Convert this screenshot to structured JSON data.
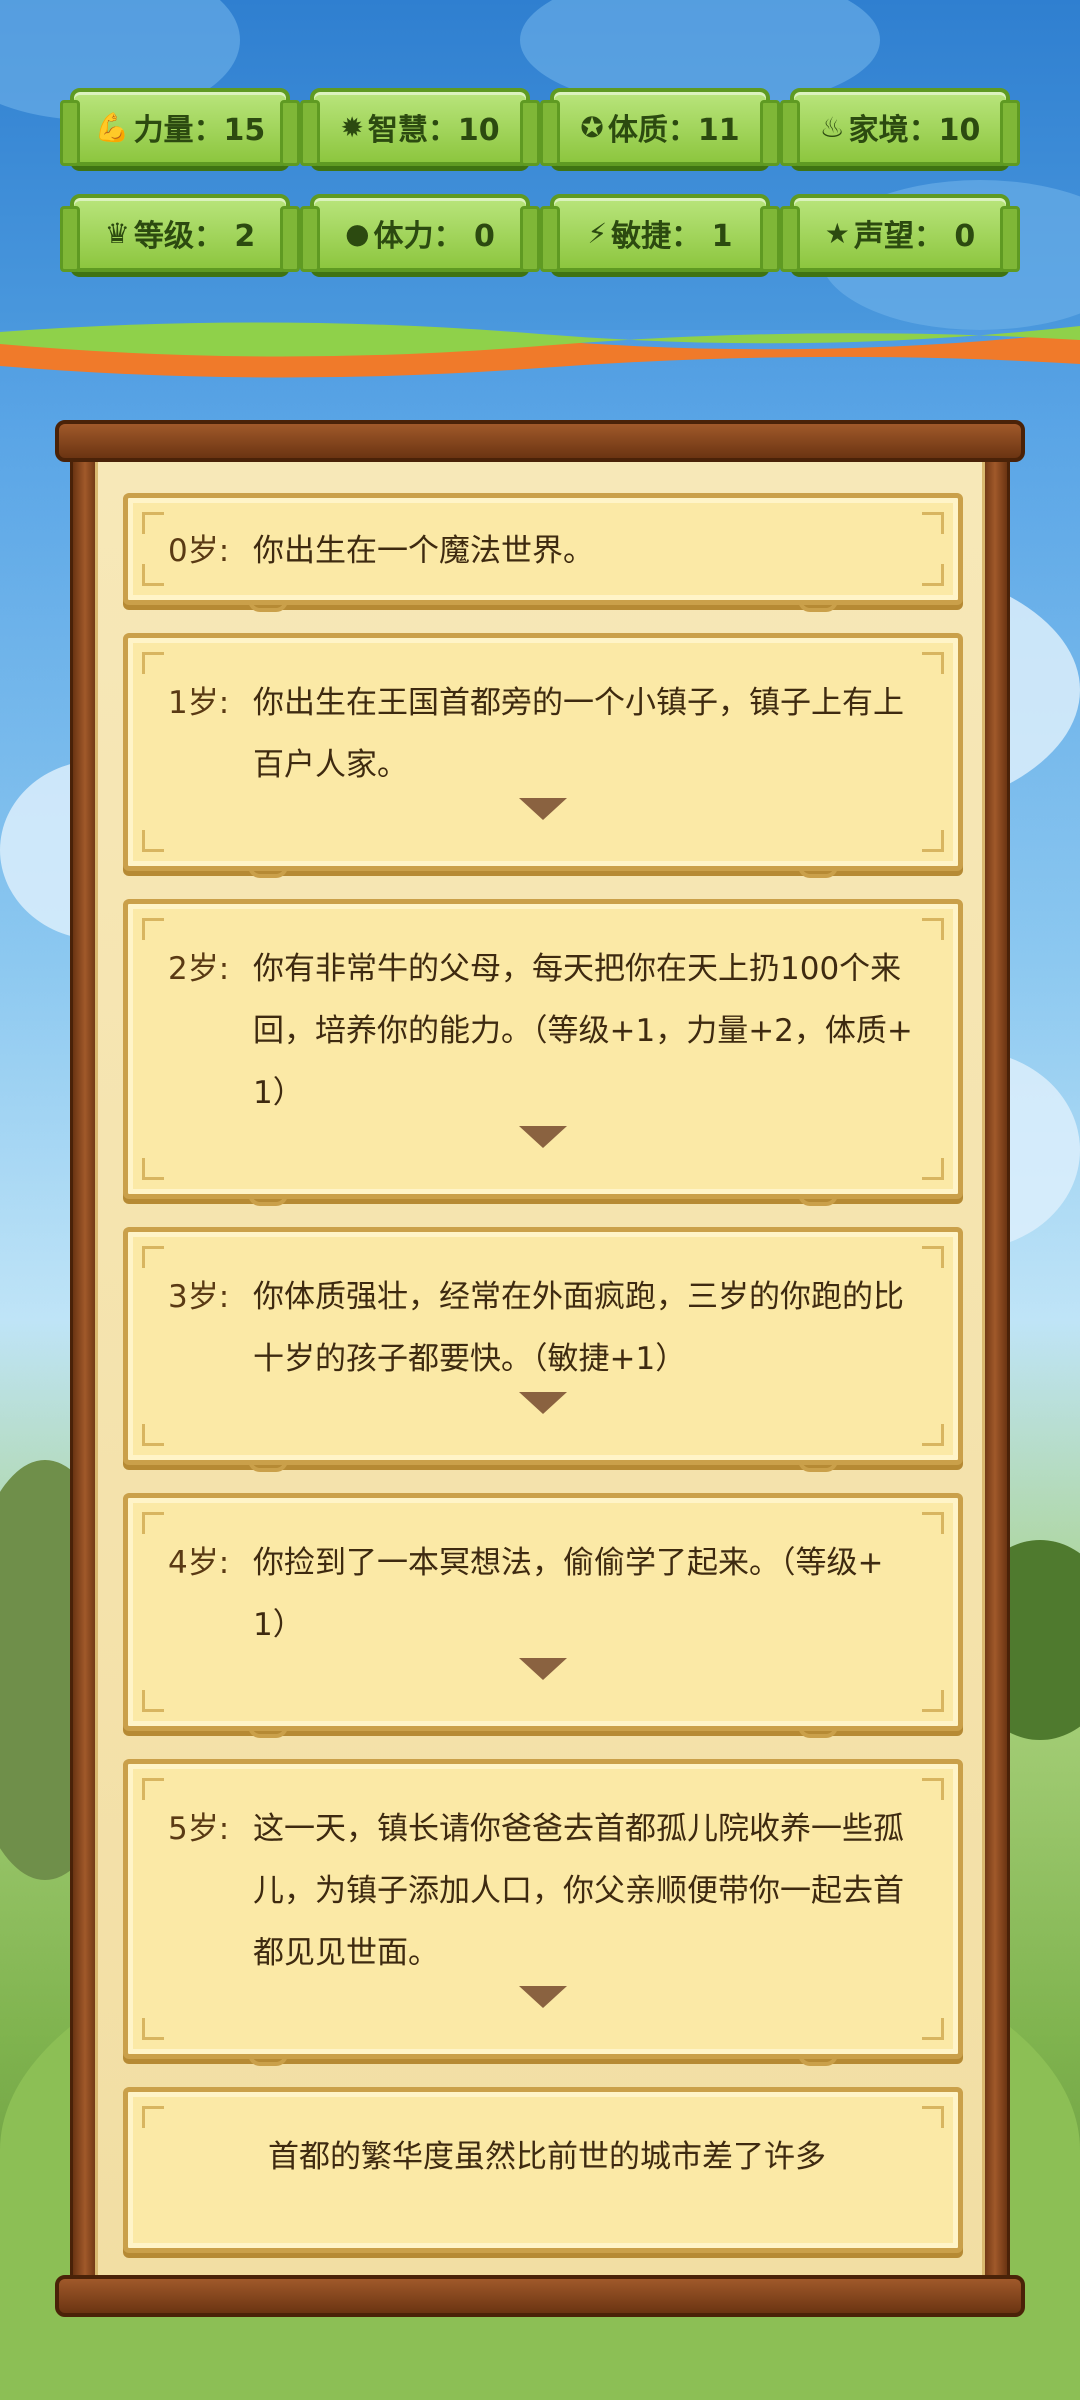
{
  "stats": [
    {
      "icon": "💪",
      "icon_name": "strength-icon",
      "label": "力量：15"
    },
    {
      "icon": "✹",
      "icon_name": "wisdom-icon",
      "label": "智慧：10"
    },
    {
      "icon": "✪",
      "icon_name": "constitution-icon",
      "label": "体质：11"
    },
    {
      "icon": "♨",
      "icon_name": "family-icon",
      "label": "家境：10"
    },
    {
      "icon": "♛",
      "icon_name": "crown-icon",
      "label": "等级： 2"
    },
    {
      "icon": "●",
      "icon_name": "stamina-icon",
      "label": "体力： 0"
    },
    {
      "icon": "⚡",
      "icon_name": "agility-icon",
      "label": "敏捷： 1"
    },
    {
      "icon": "★",
      "icon_name": "star-icon",
      "label": "声望： 0"
    }
  ],
  "events": [
    {
      "age": "0岁:",
      "text": "你出生在一个魔法世界。"
    },
    {
      "age": "1岁:",
      "text": "你出生在王国首都旁的一个小镇子，镇子上有上百户人家。"
    },
    {
      "age": "2岁:",
      "text": "你有非常牛的父母，每天把你在天上扔100个来回，培养你的能力。（等级+1，力量+2，体质+1）"
    },
    {
      "age": "3岁:",
      "text": "你体质强壮，经常在外面疯跑，三岁的你跑的比十岁的孩子都要快。（敏捷+1）"
    },
    {
      "age": "4岁:",
      "text": "你捡到了一本冥想法，偷偷学了起来。（等级+1）"
    },
    {
      "age": "5岁:",
      "text": "这一天，镇长请你爸爸去首都孤儿院收养一些孤儿，为镇子添加人口，你父亲顺便带你一起去首都见见世面。"
    },
    {
      "age": "",
      "text": "首都的繁华度虽然比前世的城市差了许多"
    }
  ],
  "colors": {
    "header_sky": "#2f7fd0",
    "stat_green": "#8dc63f",
    "paper": "#f7e8b8",
    "card": "#fbe9a6",
    "wood": "#6b3412"
  }
}
